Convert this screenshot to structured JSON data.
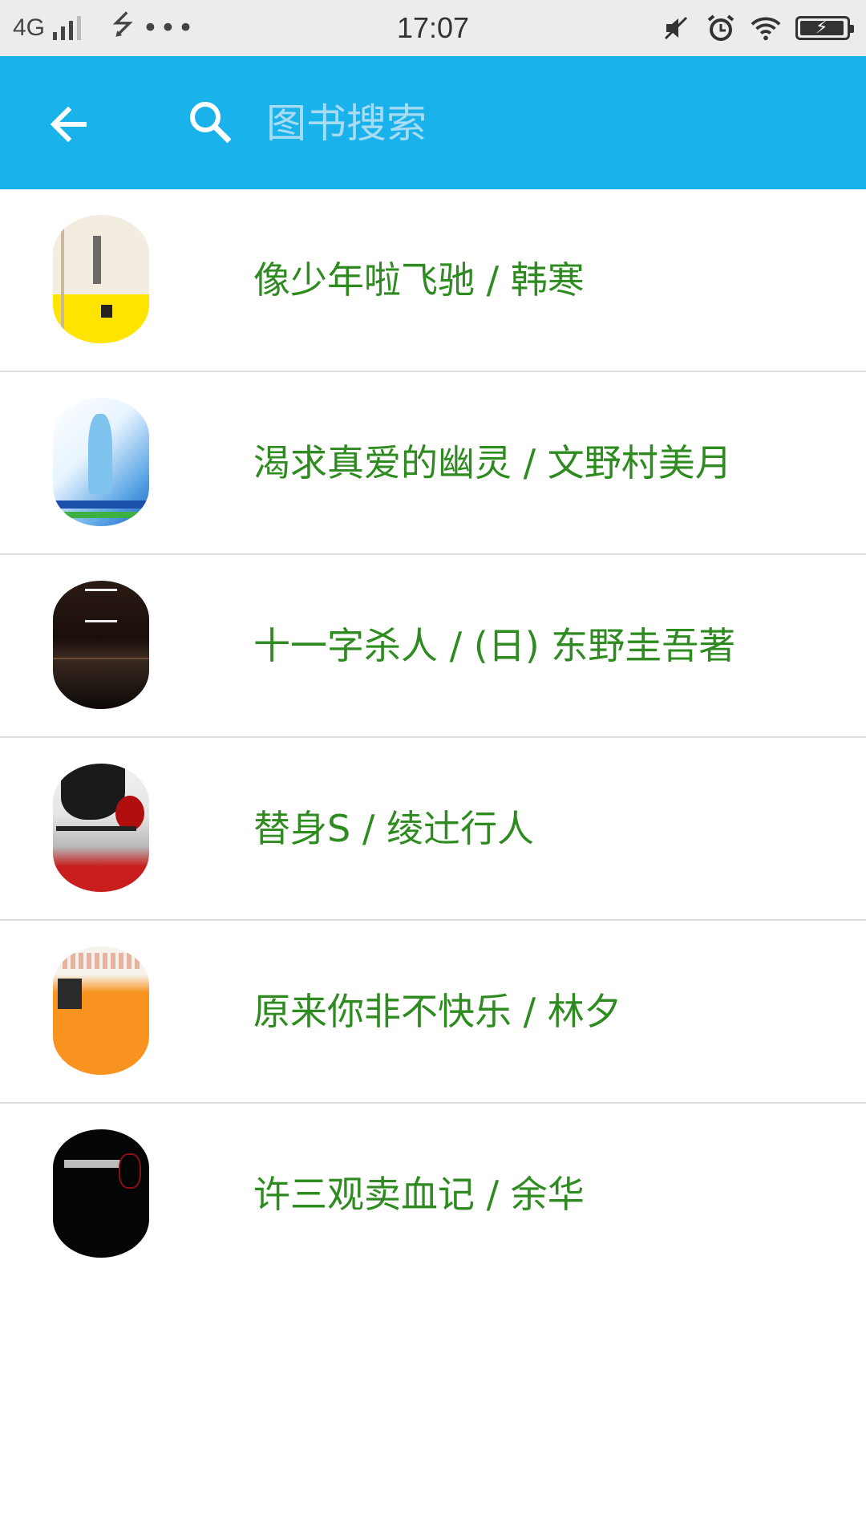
{
  "status_bar": {
    "network": "4G",
    "time": "17:07"
  },
  "search": {
    "placeholder": "图书搜索"
  },
  "books": [
    {
      "label": "像少年啦飞驰 / 韩寒"
    },
    {
      "label": "渴求真爱的幽灵 /  文野村美月"
    },
    {
      "label": "十一字杀人 / (日) 东野圭吾著"
    },
    {
      "label": "替身S /  绫辻行人"
    },
    {
      "label": "原来你非不快乐 /  林夕"
    },
    {
      "label": "许三观卖血记 / 余华"
    }
  ],
  "colors": {
    "app_bar": "#1ab2ea",
    "title_text": "#2e8b1f",
    "status_bar": "#ececec"
  },
  "icons": {
    "back": "arrow-left-icon",
    "search": "search-icon"
  }
}
